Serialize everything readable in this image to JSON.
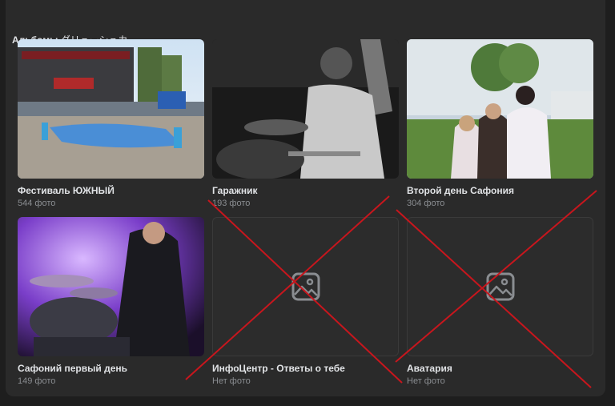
{
  "section": {
    "title": "Альбомы",
    "owner": "ダリューシュカ"
  },
  "albums": [
    {
      "title": "Фестиваль ЮЖНЫЙ",
      "count": "544 фото",
      "photo": "festival-stage"
    },
    {
      "title": "Гаражник",
      "count": "193 фото",
      "photo": "drummer-bw"
    },
    {
      "title": "Второй день Сафония",
      "count": "304 фото",
      "photo": "group-outdoor"
    },
    {
      "title": "Сафоний первый день",
      "count": "149 фото",
      "photo": "drummer-purple"
    },
    {
      "title": "ИнфоЦентр - Ответы о тебе",
      "count": "Нет фото",
      "photo": "placeholder-image-icon"
    },
    {
      "title": "Аватария",
      "count": "Нет фото",
      "photo": "placeholder-image-icon"
    }
  ],
  "colors": {
    "background": "#1e1e1e",
    "panel": "#2a2a2a",
    "title": "#e1e3e6",
    "secondary": "#8a8d91",
    "cross": "#c8161d"
  }
}
